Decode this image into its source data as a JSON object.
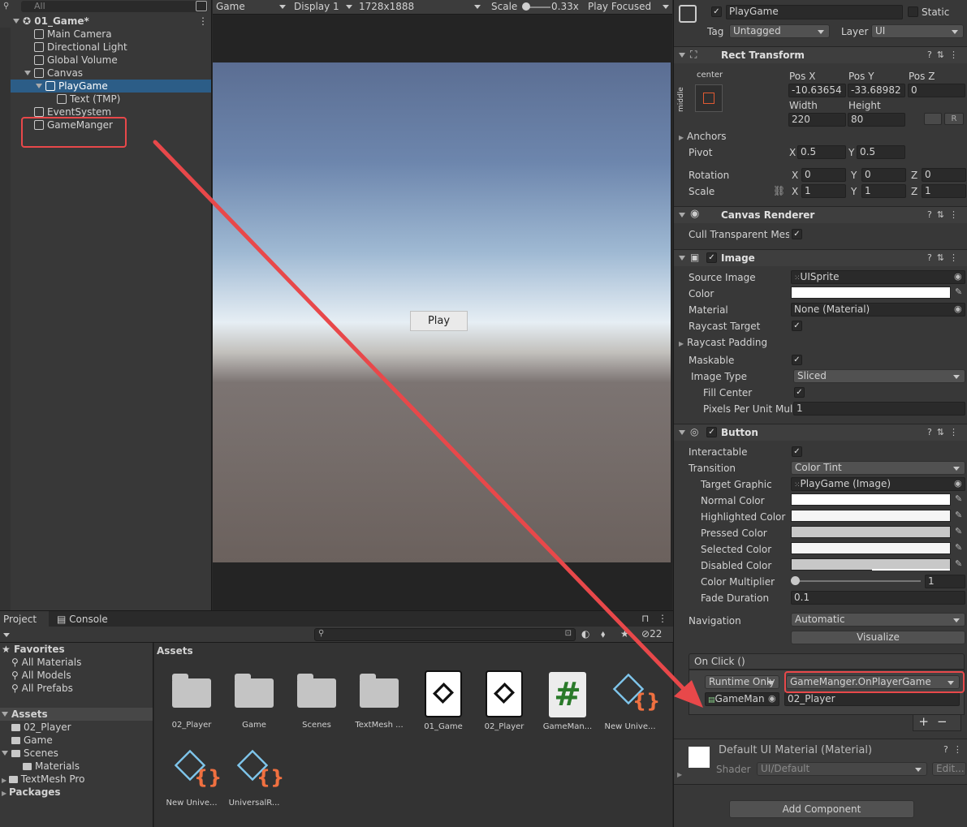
{
  "hierarchy": {
    "search_placeholder": "All",
    "scene": "01_Game*",
    "items": [
      "Main Camera",
      "Directional Light",
      "Global Volume",
      "Canvas",
      "PlayGame",
      "Text (TMP)",
      "EventSystem",
      "GameManger"
    ]
  },
  "game_toolbar": {
    "tab": "Game",
    "display": "Display 1",
    "resolution": "1728x1888",
    "scale_label": "Scale",
    "scale_value": "0.33x",
    "play_mode": "Play Focused"
  },
  "game_view": {
    "button_label": "Play"
  },
  "inspector": {
    "object_name": "PlayGame",
    "static_label": "Static",
    "tag_label": "Tag",
    "tag_value": "Untagged",
    "layer_label": "Layer",
    "layer_value": "UI",
    "rect_transform": {
      "title": "Rect Transform",
      "anchor_h": "center",
      "anchor_v": "middle",
      "posx_label": "Pos X",
      "posx": "-10.63654",
      "posy_label": "Pos Y",
      "posy": "-33.68982",
      "posz_label": "Pos Z",
      "posz": "0",
      "width_label": "Width",
      "width": "220",
      "height_label": "Height",
      "height": "80",
      "r_label": "R",
      "anchors_label": "Anchors",
      "pivot_label": "Pivot",
      "pivot_x": "0.5",
      "pivot_y": "0.5",
      "rotation_label": "Rotation",
      "rot_x": "0",
      "rot_y": "0",
      "rot_z": "0",
      "scale_label": "Scale",
      "scale_x": "1",
      "scale_y": "1",
      "scale_z": "1",
      "x": "X",
      "y": "Y",
      "z": "Z"
    },
    "canvas_renderer": {
      "title": "Canvas Renderer",
      "cull_label": "Cull Transparent Mesh"
    },
    "image": {
      "title": "Image",
      "source_label": "Source Image",
      "source_value": "UISprite",
      "color_label": "Color",
      "material_label": "Material",
      "material_value": "None (Material)",
      "raycast_label": "Raycast Target",
      "raycast_padding_label": "Raycast Padding",
      "maskable_label": "Maskable",
      "image_type_label": "Image Type",
      "image_type_value": "Sliced",
      "fill_center_label": "Fill Center",
      "ppu_label": "Pixels Per Unit Multi",
      "ppu_value": "1"
    },
    "button": {
      "title": "Button",
      "interactable_label": "Interactable",
      "transition_label": "Transition",
      "transition_value": "Color Tint",
      "target_label": "Target Graphic",
      "target_value": "PlayGame (Image)",
      "normal_label": "Normal Color",
      "highlighted_label": "Highlighted Color",
      "pressed_label": "Pressed Color",
      "selected_label": "Selected Color",
      "disabled_label": "Disabled Color",
      "multiplier_label": "Color Multiplier",
      "multiplier_value": "1",
      "fade_label": "Fade Duration",
      "fade_value": "0.1",
      "navigation_label": "Navigation",
      "navigation_value": "Automatic",
      "visualize_label": "Visualize",
      "onclick_label": "On Click ()",
      "runtime_value": "Runtime Only",
      "function_value": "GameManger.OnPlayerGame",
      "object_value": "GameMan",
      "arg_value": "02_Player"
    },
    "material": {
      "title": "Default UI Material (Material)",
      "shader_label": "Shader",
      "shader_value": "UI/Default",
      "edit_label": "Edit..."
    },
    "add_component": "Add Component"
  },
  "project": {
    "tab_project": "Project",
    "tab_console": "Console",
    "count": "22",
    "favorites_label": "Favorites",
    "favorites": [
      "All Materials",
      "All Models",
      "All Prefabs"
    ],
    "assets_label": "Assets",
    "assets_tree": [
      "02_Player",
      "Game",
      "Scenes",
      "Materials",
      "TextMesh Pro"
    ],
    "packages_label": "Packages",
    "breadcrumb": "Assets",
    "grid": [
      "02_Player",
      "Game",
      "Scenes",
      "TextMesh ...",
      "01_Game",
      "02_Player",
      "GameMan...",
      "New Unive...",
      "New Unive...",
      "UniversalR..."
    ]
  },
  "colors": {
    "accent": "#2c5d87",
    "annotation": "#e8484a"
  }
}
